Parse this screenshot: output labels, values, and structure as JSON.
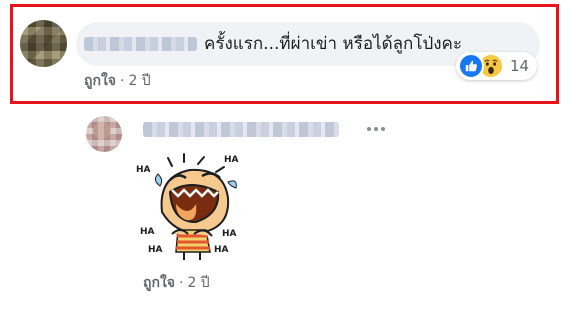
{
  "main_comment": {
    "author_name": "",
    "text": "ครั้งแรก...ที่ผ่าเข่า หรือได้ลูกโป่งคะ",
    "like_label": "ถูกใจ",
    "separator": "·",
    "time": "2 ปี",
    "reaction_count": "14",
    "reactions": [
      "like-icon",
      "wow-icon"
    ]
  },
  "reply": {
    "author_name": "",
    "sticker": "laughing-cartoon-sticker",
    "sticker_text": [
      "HA",
      "HA",
      "HA",
      "HA",
      "HA",
      "HA"
    ],
    "like_label": "ถูกใจ",
    "separator": "·",
    "time": "2 ปี"
  },
  "colors": {
    "highlight_border": "#e8141a",
    "bubble_bg": "#f0f2f5",
    "meta_text": "#65676b",
    "like_blue": "#1877f2",
    "wow_yellow": "#f7c846"
  }
}
